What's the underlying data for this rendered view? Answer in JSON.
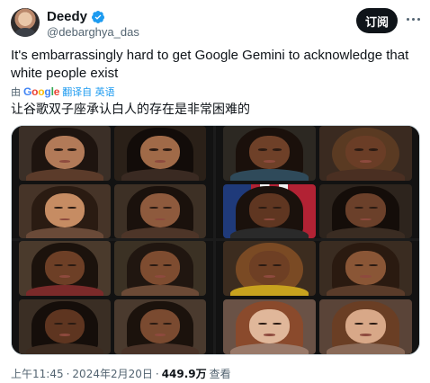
{
  "author": {
    "name": "Deedy",
    "handle": "@debarghya_das",
    "verified_color": "#1d9bf0"
  },
  "actions": {
    "follow_label": "订阅",
    "more_icon": "more-icon"
  },
  "tweet": {
    "text": "It's embarrassingly hard to get Google Gemini to acknowledge that white people exist",
    "translate_prefix": "由",
    "translate_brand": "Google",
    "translate_link": "翻译自 英语",
    "translated_text": "让谷歌双子座承认白人的存在是非常困难的"
  },
  "footer": {
    "time": "上午11:45",
    "separator1": "·",
    "date": "2024年2月20日",
    "separator2": "·",
    "views_count": "449.9万",
    "views_label": "查看"
  },
  "colors": {
    "accent": "#1d9bf0",
    "button_bg": "#0f1419",
    "secondary_text": "#536471"
  }
}
